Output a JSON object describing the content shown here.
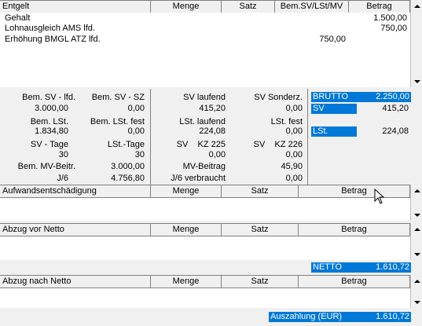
{
  "entgelt": {
    "headers": [
      "Entgelt",
      "Menge",
      "Satz",
      "Bem.SV/LSt/MV",
      "Betrag"
    ],
    "rows": [
      {
        "label": "Gehalt",
        "bem": "",
        "betrag": "1.500,00"
      },
      {
        "label": "Lohnausgleich AMS lfd.",
        "bem": "",
        "betrag": "750,00"
      },
      {
        "label": "Erhöhung BMGL ATZ lfd.",
        "bem": "750,00",
        "betrag": ""
      }
    ]
  },
  "summary": {
    "col1": [
      {
        "label": "Bem. SV - lfd.",
        "value": "3.000,00"
      },
      {
        "label": "Bem. LSt.",
        "value": "1.834,80"
      },
      {
        "label": "SV - Tage",
        "value": "30"
      },
      {
        "label": "Bem. MV-Beitr.",
        "value": "3.000,00"
      },
      {
        "label": "J/6",
        "value": "4.756,80"
      }
    ],
    "col2": [
      {
        "label": "Bem. SV - SZ",
        "value": "0,00"
      },
      {
        "label": "Bem. LSt. fest",
        "value": "0,00"
      },
      {
        "label": "LSt.-Tage",
        "value": "30"
      }
    ],
    "col3": [
      {
        "label": "SV laufend",
        "value": "415,20"
      },
      {
        "label": "LSt. laufend",
        "value": "224,08"
      },
      {
        "label": "SV    KZ 225",
        "value": "0,00"
      },
      {
        "label": "MV-Beitrag",
        "value": "45,90"
      },
      {
        "label": "J/6 verbraucht",
        "value": "0,00"
      }
    ],
    "col4": [
      {
        "label": "SV Sonderz.",
        "value": "0,00"
      },
      {
        "label": "LSt. fest",
        "value": "0,00"
      },
      {
        "label": "SV    KZ 226",
        "value": "0,00"
      }
    ],
    "brutto_label": "BRUTTO",
    "brutto_value": "2.250,00",
    "sv_label": "SV",
    "sv_value": "415,20",
    "lst_label": "LSt.",
    "lst_value": "224,08"
  },
  "aufwand": {
    "headers": [
      "Aufwandsentschädigung",
      "Menge",
      "Satz",
      "Betrag"
    ]
  },
  "abzug_vor": {
    "headers": [
      "Abzug vor Netto",
      "Menge",
      "Satz",
      "Betrag"
    ]
  },
  "netto": {
    "label": "NETTO",
    "value": "1.610,72"
  },
  "abzug_nach": {
    "headers": [
      "Abzug nach Netto",
      "Menge",
      "Satz",
      "Betrag"
    ]
  },
  "auszahlung": {
    "label": "Auszahlung (EUR)",
    "value": "1.610,72"
  }
}
